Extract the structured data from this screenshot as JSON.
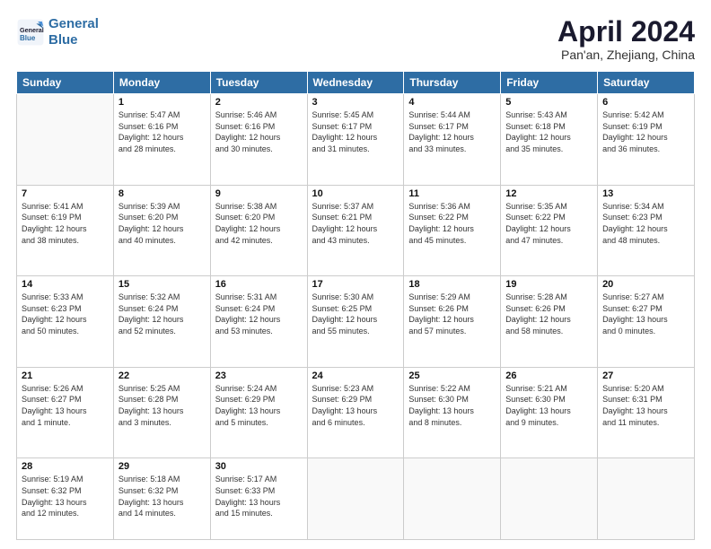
{
  "header": {
    "logo_line1": "General",
    "logo_line2": "Blue",
    "month": "April 2024",
    "location": "Pan'an, Zhejiang, China"
  },
  "weekdays": [
    "Sunday",
    "Monday",
    "Tuesday",
    "Wednesday",
    "Thursday",
    "Friday",
    "Saturday"
  ],
  "weeks": [
    [
      {
        "day": "",
        "info": ""
      },
      {
        "day": "1",
        "info": "Sunrise: 5:47 AM\nSunset: 6:16 PM\nDaylight: 12 hours\nand 28 minutes."
      },
      {
        "day": "2",
        "info": "Sunrise: 5:46 AM\nSunset: 6:16 PM\nDaylight: 12 hours\nand 30 minutes."
      },
      {
        "day": "3",
        "info": "Sunrise: 5:45 AM\nSunset: 6:17 PM\nDaylight: 12 hours\nand 31 minutes."
      },
      {
        "day": "4",
        "info": "Sunrise: 5:44 AM\nSunset: 6:17 PM\nDaylight: 12 hours\nand 33 minutes."
      },
      {
        "day": "5",
        "info": "Sunrise: 5:43 AM\nSunset: 6:18 PM\nDaylight: 12 hours\nand 35 minutes."
      },
      {
        "day": "6",
        "info": "Sunrise: 5:42 AM\nSunset: 6:19 PM\nDaylight: 12 hours\nand 36 minutes."
      }
    ],
    [
      {
        "day": "7",
        "info": "Sunrise: 5:41 AM\nSunset: 6:19 PM\nDaylight: 12 hours\nand 38 minutes."
      },
      {
        "day": "8",
        "info": "Sunrise: 5:39 AM\nSunset: 6:20 PM\nDaylight: 12 hours\nand 40 minutes."
      },
      {
        "day": "9",
        "info": "Sunrise: 5:38 AM\nSunset: 6:20 PM\nDaylight: 12 hours\nand 42 minutes."
      },
      {
        "day": "10",
        "info": "Sunrise: 5:37 AM\nSunset: 6:21 PM\nDaylight: 12 hours\nand 43 minutes."
      },
      {
        "day": "11",
        "info": "Sunrise: 5:36 AM\nSunset: 6:22 PM\nDaylight: 12 hours\nand 45 minutes."
      },
      {
        "day": "12",
        "info": "Sunrise: 5:35 AM\nSunset: 6:22 PM\nDaylight: 12 hours\nand 47 minutes."
      },
      {
        "day": "13",
        "info": "Sunrise: 5:34 AM\nSunset: 6:23 PM\nDaylight: 12 hours\nand 48 minutes."
      }
    ],
    [
      {
        "day": "14",
        "info": "Sunrise: 5:33 AM\nSunset: 6:23 PM\nDaylight: 12 hours\nand 50 minutes."
      },
      {
        "day": "15",
        "info": "Sunrise: 5:32 AM\nSunset: 6:24 PM\nDaylight: 12 hours\nand 52 minutes."
      },
      {
        "day": "16",
        "info": "Sunrise: 5:31 AM\nSunset: 6:24 PM\nDaylight: 12 hours\nand 53 minutes."
      },
      {
        "day": "17",
        "info": "Sunrise: 5:30 AM\nSunset: 6:25 PM\nDaylight: 12 hours\nand 55 minutes."
      },
      {
        "day": "18",
        "info": "Sunrise: 5:29 AM\nSunset: 6:26 PM\nDaylight: 12 hours\nand 57 minutes."
      },
      {
        "day": "19",
        "info": "Sunrise: 5:28 AM\nSunset: 6:26 PM\nDaylight: 12 hours\nand 58 minutes."
      },
      {
        "day": "20",
        "info": "Sunrise: 5:27 AM\nSunset: 6:27 PM\nDaylight: 13 hours\nand 0 minutes."
      }
    ],
    [
      {
        "day": "21",
        "info": "Sunrise: 5:26 AM\nSunset: 6:27 PM\nDaylight: 13 hours\nand 1 minute."
      },
      {
        "day": "22",
        "info": "Sunrise: 5:25 AM\nSunset: 6:28 PM\nDaylight: 13 hours\nand 3 minutes."
      },
      {
        "day": "23",
        "info": "Sunrise: 5:24 AM\nSunset: 6:29 PM\nDaylight: 13 hours\nand 5 minutes."
      },
      {
        "day": "24",
        "info": "Sunrise: 5:23 AM\nSunset: 6:29 PM\nDaylight: 13 hours\nand 6 minutes."
      },
      {
        "day": "25",
        "info": "Sunrise: 5:22 AM\nSunset: 6:30 PM\nDaylight: 13 hours\nand 8 minutes."
      },
      {
        "day": "26",
        "info": "Sunrise: 5:21 AM\nSunset: 6:30 PM\nDaylight: 13 hours\nand 9 minutes."
      },
      {
        "day": "27",
        "info": "Sunrise: 5:20 AM\nSunset: 6:31 PM\nDaylight: 13 hours\nand 11 minutes."
      }
    ],
    [
      {
        "day": "28",
        "info": "Sunrise: 5:19 AM\nSunset: 6:32 PM\nDaylight: 13 hours\nand 12 minutes."
      },
      {
        "day": "29",
        "info": "Sunrise: 5:18 AM\nSunset: 6:32 PM\nDaylight: 13 hours\nand 14 minutes."
      },
      {
        "day": "30",
        "info": "Sunrise: 5:17 AM\nSunset: 6:33 PM\nDaylight: 13 hours\nand 15 minutes."
      },
      {
        "day": "",
        "info": ""
      },
      {
        "day": "",
        "info": ""
      },
      {
        "day": "",
        "info": ""
      },
      {
        "day": "",
        "info": ""
      }
    ]
  ]
}
